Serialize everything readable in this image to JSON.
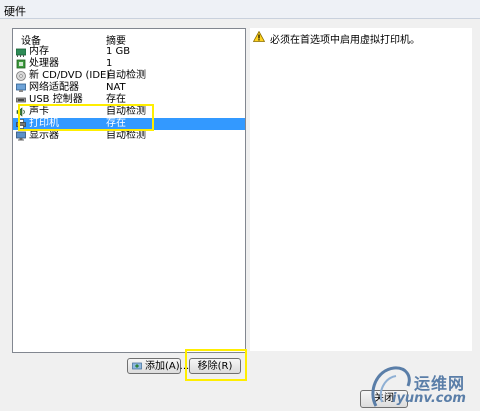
{
  "window": {
    "title": "硬件"
  },
  "device_list": {
    "columns": [
      "设备",
      "摘要"
    ],
    "rows": [
      {
        "icon": "memory-icon",
        "name": "内存",
        "summary": "1 GB"
      },
      {
        "icon": "processor-icon",
        "name": "处理器",
        "summary": "1"
      },
      {
        "icon": "cd-dvd-icon",
        "name": "新 CD/DVD (IDE)",
        "summary": "自动检测"
      },
      {
        "icon": "network-adapter-icon",
        "name": "网络适配器",
        "summary": "NAT"
      },
      {
        "icon": "usb-controller-icon",
        "name": "USB 控制器",
        "summary": "存在"
      },
      {
        "icon": "sound-card-icon",
        "name": "声卡",
        "summary": "自动检测"
      },
      {
        "icon": "printer-icon",
        "name": "打印机",
        "summary": "存在",
        "selected": true
      },
      {
        "icon": "display-icon",
        "name": "显示器",
        "summary": "自动检测"
      }
    ]
  },
  "info": {
    "warning": "必须在首选项中启用虚拟打印机。",
    "icon": "warning-icon"
  },
  "buttons": {
    "add": "添加(A)...",
    "remove": "移除(R)",
    "close": "关闭"
  },
  "watermark": {
    "cn": "运维网",
    "en": "iyunv.com"
  },
  "colors": {
    "selection": "#3399ff",
    "highlight": "#ffee00"
  }
}
